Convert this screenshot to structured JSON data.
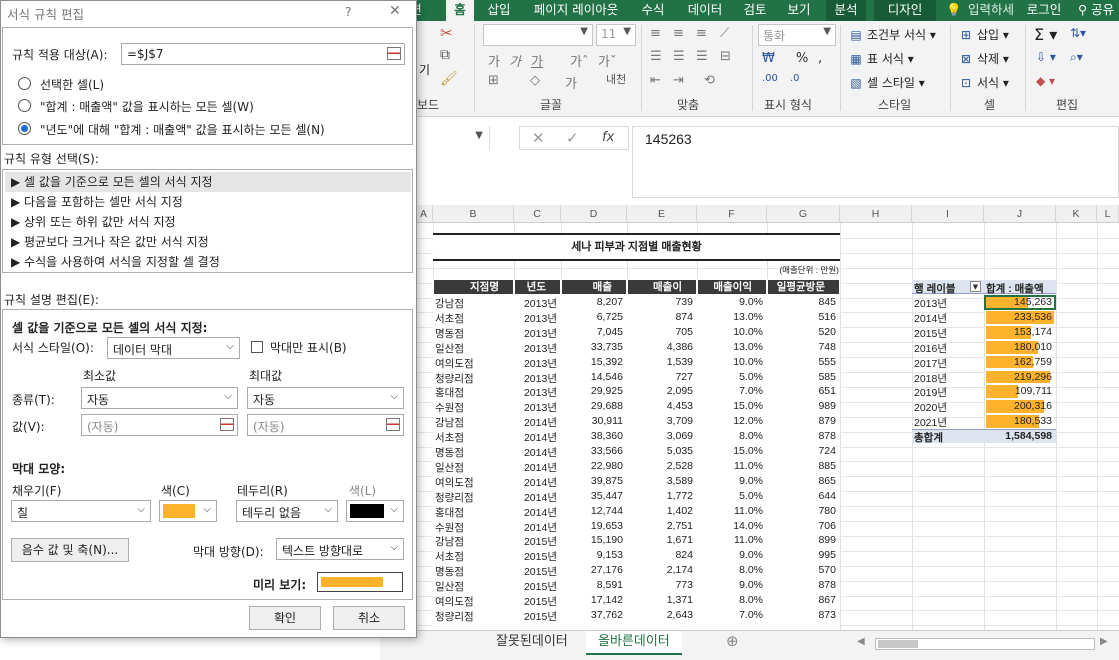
{
  "ribbon": {
    "tabs": [
      "홈",
      "삽입",
      "페이지 레이아웃",
      "수식",
      "데이터",
      "검토",
      "보기",
      "분석",
      "디자인",
      "입력하세",
      "로그인",
      "공유"
    ],
    "partial_tab": "편",
    "font_size": "11",
    "number_format": "통화",
    "groups": [
      "보드",
      "글꼴",
      "맞춤",
      "표시 형식",
      "스타일",
      "셀",
      "편집"
    ],
    "style_items": [
      "조건부 서식",
      "표 서식",
      "셀 스타일"
    ],
    "cell_items": [
      "삽입",
      "삭제",
      "서식"
    ],
    "align_text": "내천",
    "paste_label": "기",
    "number_symbols": "%",
    "accent": "#217346"
  },
  "formula": {
    "value": "145263",
    "fx": "fx"
  },
  "columns": [
    "A",
    "B",
    "C",
    "D",
    "E",
    "F",
    "G",
    "H",
    "I",
    "J",
    "K",
    "L"
  ],
  "sheet": {
    "title": "세나 피부과 지점별 매출현황",
    "unit": "(매출단위 : 만원)",
    "headers": [
      "지점명",
      "년도",
      "매출",
      "매출이",
      "매출이익",
      "일평균방문"
    ],
    "rows": [
      [
        "강남점",
        "2013년",
        "8,207",
        "739",
        "9.0%",
        "845"
      ],
      [
        "서초점",
        "2013년",
        "6,725",
        "874",
        "13.0%",
        "516"
      ],
      [
        "명동점",
        "2013년",
        "7,045",
        "705",
        "10.0%",
        "520"
      ],
      [
        "일산점",
        "2013년",
        "33,735",
        "4,386",
        "13.0%",
        "748"
      ],
      [
        "여의도점",
        "2013년",
        "15,392",
        "1,539",
        "10.0%",
        "555"
      ],
      [
        "청량리점",
        "2013년",
        "14,546",
        "727",
        "5.0%",
        "585"
      ],
      [
        "홍대점",
        "2013년",
        "29,925",
        "2,095",
        "7.0%",
        "651"
      ],
      [
        "수원점",
        "2013년",
        "29,688",
        "4,453",
        "15.0%",
        "989"
      ],
      [
        "강남점",
        "2014년",
        "30,911",
        "3,709",
        "12.0%",
        "879"
      ],
      [
        "서초점",
        "2014년",
        "38,360",
        "3,069",
        "8.0%",
        "878"
      ],
      [
        "명동점",
        "2014년",
        "33,566",
        "5,035",
        "15.0%",
        "724"
      ],
      [
        "일산점",
        "2014년",
        "22,980",
        "2,528",
        "11.0%",
        "885"
      ],
      [
        "여의도점",
        "2014년",
        "39,875",
        "3,589",
        "9.0%",
        "865"
      ],
      [
        "청량리점",
        "2014년",
        "35,447",
        "1,772",
        "5.0%",
        "644"
      ],
      [
        "홍대점",
        "2014년",
        "12,744",
        "1,402",
        "11.0%",
        "780"
      ],
      [
        "수원점",
        "2014년",
        "19,653",
        "2,751",
        "14.0%",
        "706"
      ],
      [
        "강남점",
        "2015년",
        "15,190",
        "1,671",
        "11.0%",
        "899"
      ],
      [
        "서초점",
        "2015년",
        "9,153",
        "824",
        "9.0%",
        "995"
      ],
      [
        "명동점",
        "2015년",
        "27,176",
        "2,174",
        "8.0%",
        "570"
      ],
      [
        "일산점",
        "2015년",
        "8,591",
        "773",
        "9.0%",
        "878"
      ],
      [
        "여의도점",
        "2015년",
        "17,142",
        "1,371",
        "8.0%",
        "867"
      ],
      [
        "청량리점",
        "2015년",
        "37,762",
        "2,643",
        "7.0%",
        "873"
      ]
    ],
    "pivot": {
      "header_label": "행 레이블",
      "header_value": "합계 : 매출액",
      "rows": [
        [
          "2013년",
          "145,263",
          145263
        ],
        [
          "2014년",
          "233,536",
          233536
        ],
        [
          "2015년",
          "153,174",
          153174
        ],
        [
          "2016년",
          "180,010",
          180010
        ],
        [
          "2017년",
          "162,759",
          162759
        ],
        [
          "2018년",
          "219,296",
          219296
        ],
        [
          "2019년",
          "109,711",
          109711
        ],
        [
          "2020년",
          "200,316",
          200316
        ],
        [
          "2021년",
          "180,533",
          180533
        ]
      ],
      "total_label": "총합계",
      "total_value": "1,584,598",
      "bar_color": "#FFB22B"
    }
  },
  "sheet_tabs": [
    "잘못된데이터",
    "올바른데이터"
  ],
  "dialog": {
    "title": "서식 규칙 편집",
    "help": "?",
    "close": "✕",
    "apply_label": "규칙 적용 대상(A):",
    "apply_value": "=$J$7",
    "radios": [
      "선택한 셀(L)",
      "\"합계 : 매출액\" 값을 표시하는 모든 셀(W)",
      "\"년도\"에 대해 \"합계 : 매출액\" 값을 표시하는 모든 셀(N)"
    ],
    "rule_type_label": "규칙 유형 선택(S):",
    "rule_types": [
      "▶ 셀 값을 기준으로 모든 셀의 서식 지정",
      "▶ 다음을 포함하는 셀만 서식 지정",
      "▶ 상위 또는 하위 값만 서식 지정",
      "▶ 평균보다 크거나 작은 값만 서식 지정",
      "▶ 수식을 사용하여 서식을 지정할 셀 결정"
    ],
    "desc_label": "규칙 설명 편집(E):",
    "desc_title": "셀 값을 기준으로 모든 셀의 서식 지정:",
    "format_style_label": "서식 스타일(O):",
    "format_style_value": "데이터 막대",
    "bar_only_label": "막대만 표시(B)",
    "min_label": "최소값",
    "max_label": "최대값",
    "type_label": "종류(T):",
    "min_type": "자동",
    "max_type": "자동",
    "value_label": "값(V):",
    "min_value": "(자동)",
    "max_value": "(자동)",
    "bar_shape_label": "막대 모양:",
    "fill_label": "채우기(F)",
    "fill_value": "칠",
    "color_label": "색(C)",
    "border_label": "테두리(R)",
    "border_value": "테두리 없음",
    "border_color_label": "색(L)",
    "neg_button": "음수 값 및 축(N)...",
    "direction_label": "막대 방향(D):",
    "direction_value": "텍스트 방향대로",
    "preview_label": "미리 보기:",
    "ok": "확인",
    "cancel": "취소",
    "fill_color": "#FFB22B",
    "border_color": "#000000"
  }
}
